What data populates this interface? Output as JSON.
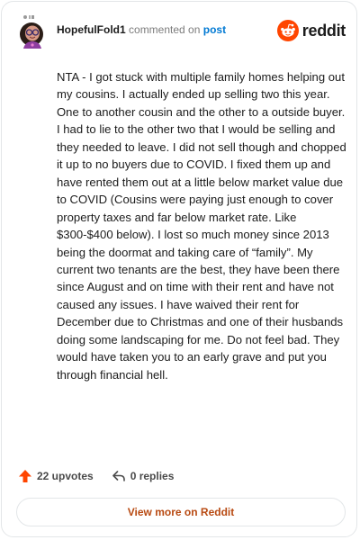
{
  "comment": {
    "username": "HopefulFold1",
    "action_text": "commented on",
    "target_link": "post",
    "text": "NTA - I got stuck with multiple family homes helping out my cousins. I actually ended up selling two this year. One to another cousin and the other to a outside buyer. I had to lie to the other two that I would be selling and they needed to leave. I did not sell though and chopped it up to no buyers due to COVID. I fixed them up and have rented them out at a little below market value due to COVID (Cousins were paying just enough to cover property taxes and far below market rate. Like $300-$400 below). I lost so much money since 2013 being the doormat and taking care of “family”. My current two tenants are the best, they have been there since August and on time with their rent and have not caused any issues. I have waived their rent for December due to Christmas and one of their husbands doing some landscaping for me. Do not feel bad. They would have taken you to an early grave and put you through financial hell."
  },
  "brand": {
    "name": "reddit",
    "icon": "reddit-logo-icon",
    "color": "#ff4500"
  },
  "actions": {
    "upvotes_label": "22 upvotes",
    "replies_label": "0 replies",
    "upvote_icon": "upvote-arrow-icon",
    "reply_icon": "reply-arrow-icon"
  },
  "footer": {
    "view_more_label": "View more on Reddit"
  },
  "colors": {
    "accent_link": "#0079d3",
    "upvote": "#ff4500",
    "view_more_text": "#b84a12",
    "border": "#e3e6e8"
  }
}
